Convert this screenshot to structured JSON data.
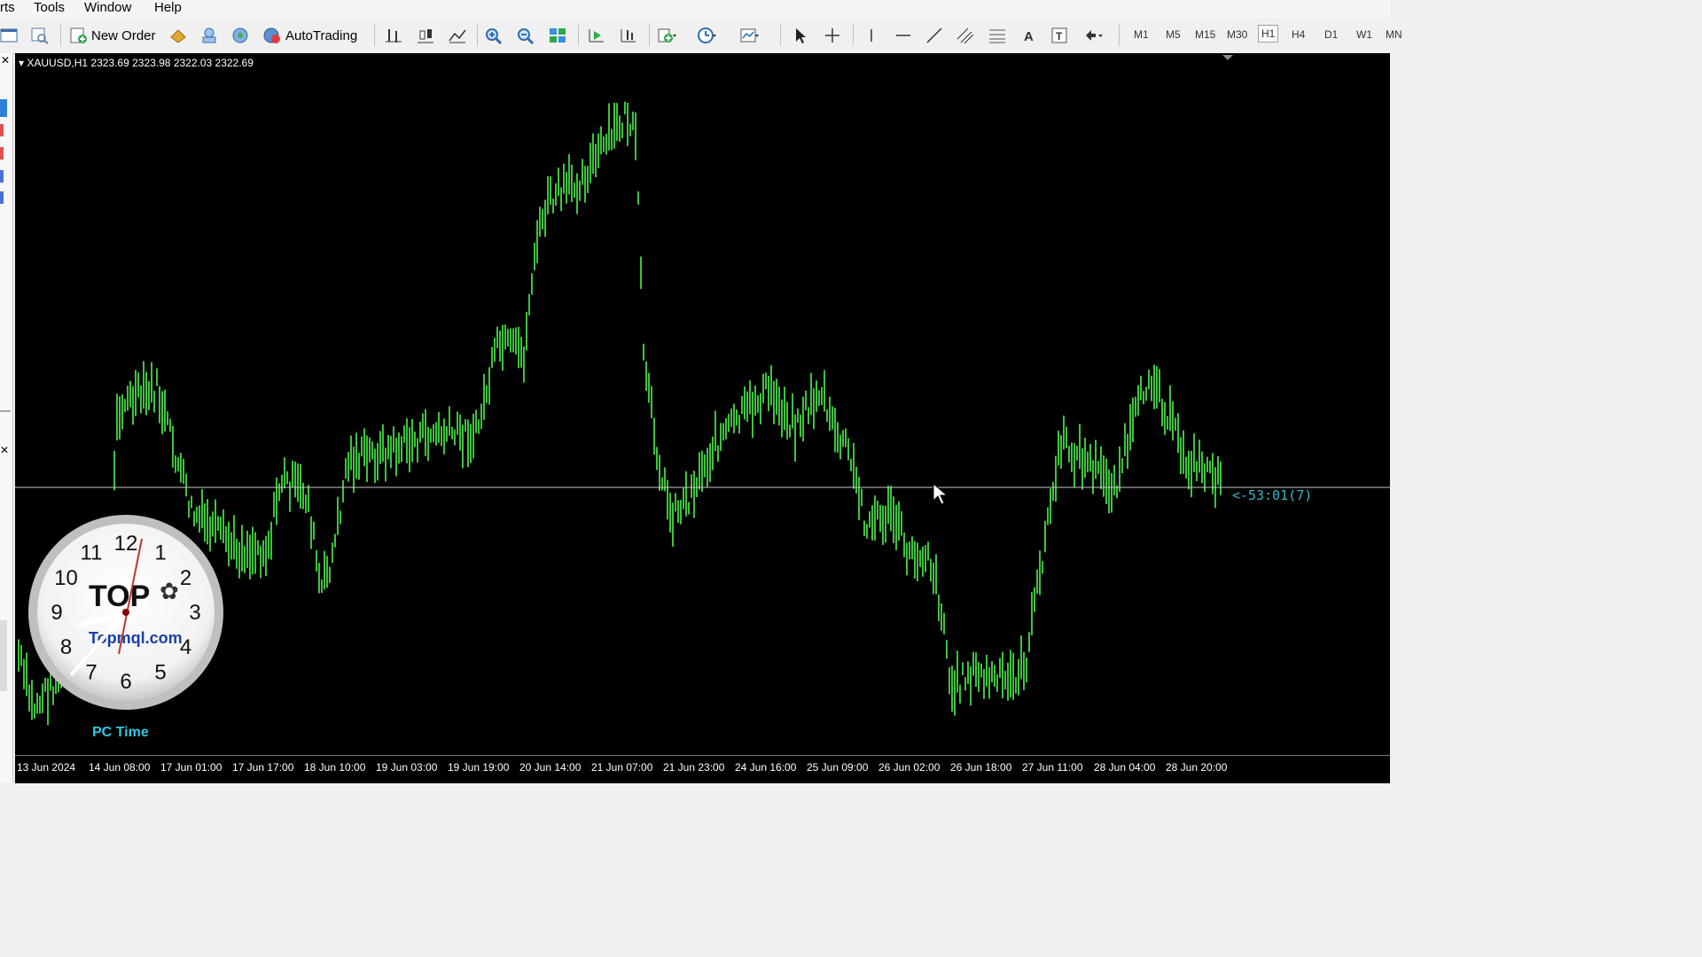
{
  "menu": {
    "items": [
      "rts",
      "Tools",
      "Window",
      "Help"
    ]
  },
  "toolbar": {
    "new_order": "New Order",
    "autotrading": "AutoTrading",
    "timeframes": [
      "M1",
      "M5",
      "M15",
      "M30",
      "H1",
      "H4",
      "D1",
      "W1",
      "MN"
    ],
    "active_timeframe": "H1",
    "icons": [
      "new-chart-icon",
      "profiles-icon",
      "new-order-icon",
      "market-watch-icon",
      "navigator-icon",
      "terminal-icon",
      "autotrading-icon",
      "bar-chart-icon",
      "candlestick-icon",
      "line-chart-icon",
      "zoom-in-icon",
      "zoom-out-icon",
      "tile-windows-icon",
      "auto-scroll-icon",
      "chart-shift-icon",
      "indicators-icon",
      "periods-icon",
      "templates-icon",
      "cursor-icon",
      "crosshair-icon",
      "vertical-line-icon",
      "horizontal-line-icon",
      "trendline-icon",
      "equidistant-channel-icon",
      "fibonacci-icon",
      "text-icon",
      "text-label-icon",
      "arrows-icon"
    ]
  },
  "chart": {
    "symbol_info": "XAUUSD,H1  2323.69 2323.98 2322.03 2322.69",
    "timer_label": "<-53:01(7)",
    "pc_time_label": "PC Time",
    "clock_numbers": [
      "12",
      "1",
      "2",
      "3",
      "4",
      "5",
      "6",
      "7",
      "8",
      "9",
      "10",
      "11"
    ],
    "clock_logo": "TOP",
    "clock_site": "Topmql.com",
    "colors": {
      "background": "#000000",
      "bars": "#3ec33e",
      "grid_line": "#c8c8c8",
      "timer": "#39b7c4",
      "pc_time": "#2ec9e3"
    }
  },
  "chart_data": {
    "type": "bar",
    "symbol": "XAUUSD",
    "timeframe": "H1",
    "x_labels": [
      "13 Jun 2024",
      "14 Jun 08:00",
      "17 Jun 01:00",
      "17 Jun 17:00",
      "18 Jun 10:00",
      "19 Jun 03:00",
      "19 Jun 19:00",
      "20 Jun 14:00",
      "21 Jun 07:00",
      "21 Jun 23:00",
      "24 Jun 16:00",
      "25 Jun 09:00",
      "26 Jun 02:00",
      "26 Jun 18:00",
      "27 Jun 11:00",
      "28 Jun 04:00",
      "28 Jun 20:00"
    ],
    "last_bar": {
      "open": 2323.69,
      "high": 2323.98,
      "low": 2322.03,
      "close": 2322.69
    },
    "current_price": 2322.69,
    "grid": false
  }
}
